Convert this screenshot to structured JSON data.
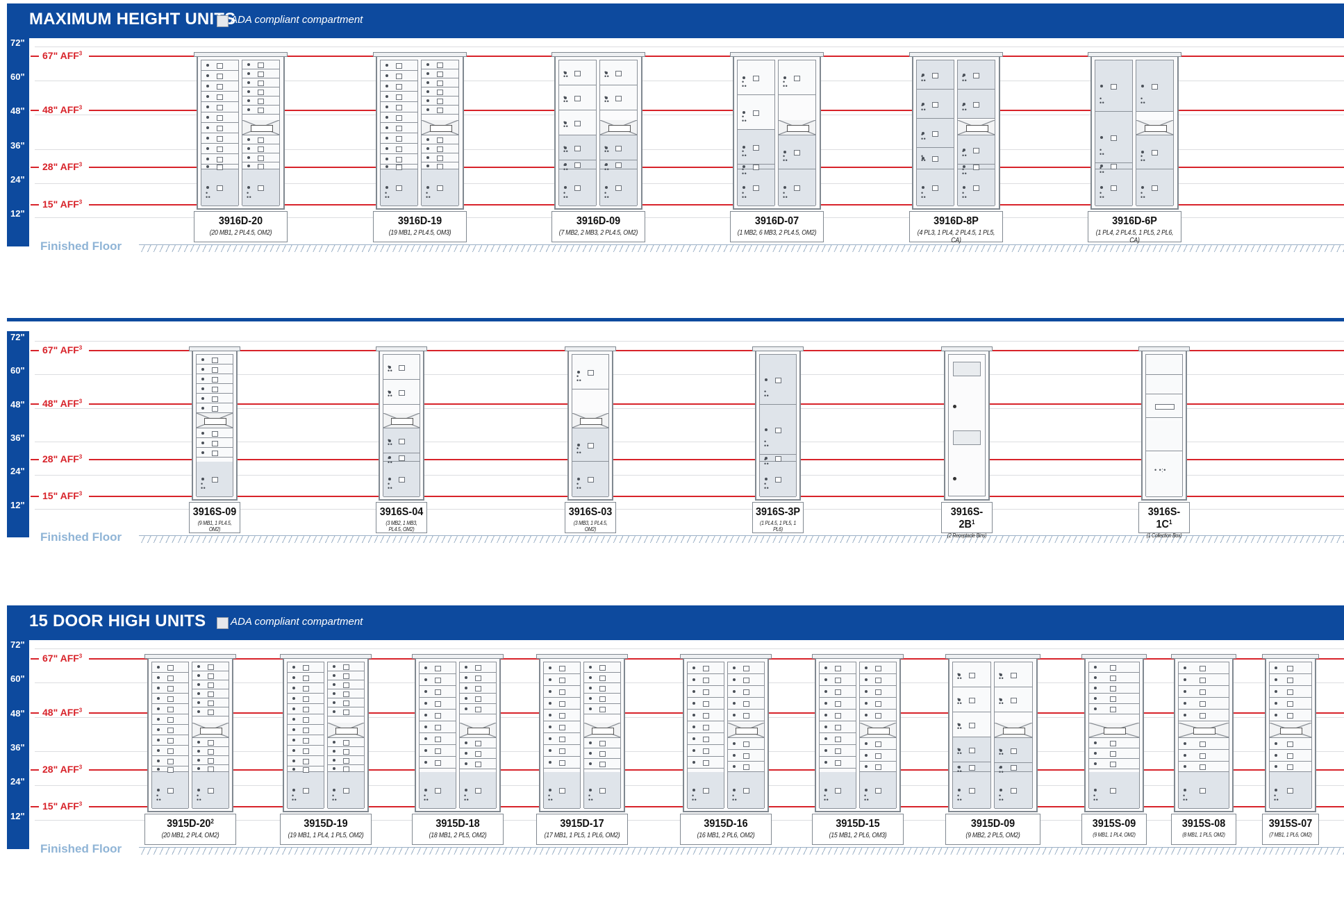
{
  "sections": [
    {
      "title": "MAXIMUM HEIGHT UNITS",
      "ada_legend": "ADA compliant compartment",
      "units": [
        {
          "name": "3916D-20",
          "sup": "",
          "desc": "(20 MB1, 2 PL4.5, OM2)",
          "cols": 2,
          "top": "mb",
          "n": 20
        },
        {
          "name": "3916D-19",
          "sup": "",
          "desc": "(19 MB1, 2 PL4.5, OM3)",
          "cols": 2,
          "top": "mb",
          "n": 19
        },
        {
          "name": "3916D-09",
          "sup": "",
          "desc": "(7 MB2, 2 MB3, 2 PL4.5, OM2)",
          "cols": 2,
          "top": "mb2",
          "n": 9
        },
        {
          "name": "3916D-07",
          "sup": "",
          "desc": "(1 MB2, 6 MB3, 2 PL4.5, OM2)",
          "cols": 2,
          "top": "mb3",
          "n": 7
        },
        {
          "name": "3916D-8P",
          "sup": "",
          "desc": "(4 PL3, 1 PL4, 2 PL4.5, 1 PL5, CA)",
          "cols": 2,
          "top": "pl",
          "n": 8
        },
        {
          "name": "3916D-6P",
          "sup": "",
          "desc": "(1 PL4, 2 PL4.5, 1 PL5, 2 PL6, CA)",
          "cols": 2,
          "top": "pl6",
          "n": 6
        }
      ]
    },
    {
      "title": "",
      "ada_legend": "",
      "units": [
        {
          "name": "3916S-09",
          "sup": "",
          "desc": "(9 MB1, 1 PL4.5, OM2)",
          "cols": 1,
          "top": "mb",
          "n": 9
        },
        {
          "name": "3916S-04",
          "sup": "",
          "desc": "(3 MB2, 1 MB3, PL4.5, OM2)",
          "cols": 1,
          "top": "mb2",
          "n": 4
        },
        {
          "name": "3916S-03",
          "sup": "",
          "desc": "(3 MB3, 1 PL4.5, OM2)",
          "cols": 1,
          "top": "mb3",
          "n": 3
        },
        {
          "name": "3916S-3P",
          "sup": "",
          "desc": "(1 PL4.5, 1 PL5, 1 PL6)",
          "cols": 1,
          "top": "pl6",
          "n": 3
        },
        {
          "name": "3916S-2B",
          "sup": "1",
          "desc": "(2 Receptacle Bins)",
          "cols": 1,
          "top": "bin",
          "n": 2
        },
        {
          "name": "3916S-1C",
          "sup": "1",
          "desc": "(1 Collection Box)",
          "cols": 1,
          "top": "cbox",
          "n": 1
        }
      ]
    },
    {
      "title": "15 DOOR HIGH UNITS",
      "ada_legend": "ADA compliant compartment",
      "units": [
        {
          "name": "3915D-20",
          "sup": "2",
          "desc": "(20 MB1, 2 PL4, OM2)",
          "cols": 2,
          "top": "mb",
          "n": 20
        },
        {
          "name": "3915D-19",
          "sup": "",
          "desc": "(19 MB1, 1 PL4, 1 PL5, OM2)",
          "cols": 2,
          "top": "mb",
          "n": 19
        },
        {
          "name": "3915D-18",
          "sup": "",
          "desc": "(18 MB1, 2 PL5, OM2)",
          "cols": 2,
          "top": "mb",
          "n": 18
        },
        {
          "name": "3915D-17",
          "sup": "",
          "desc": "(17 MB1, 1 PL5, 1 PL6, OM2)",
          "cols": 2,
          "top": "mb",
          "n": 17
        },
        {
          "name": "3915D-16",
          "sup": "",
          "desc": "(16 MB1, 2 PL6, OM2)",
          "cols": 2,
          "top": "mb",
          "n": 16
        },
        {
          "name": "3915D-15",
          "sup": "",
          "desc": "(15 MB1, 2 PL6, OM3)",
          "cols": 2,
          "top": "mb",
          "n": 15
        },
        {
          "name": "3915D-09",
          "sup": "",
          "desc": "(9 MB2, 2 PL5, OM2)",
          "cols": 2,
          "top": "mb2",
          "n": 9
        },
        {
          "name": "3915S-09",
          "sup": "",
          "desc": "(9 MB1, 1 PL4, OM2)",
          "cols": 1,
          "top": "mb",
          "n": 9
        },
        {
          "name": "3915S-08",
          "sup": "",
          "desc": "(8 MB1, 1 PL5, OM2)",
          "cols": 1,
          "top": "mb",
          "n": 8
        },
        {
          "name": "3915S-07",
          "sup": "",
          "desc": "(7 MB1, 1 PL6, OM2)",
          "cols": 1,
          "top": "mb",
          "n": 7
        }
      ]
    }
  ],
  "ruler_ticks": [
    "72\"",
    "60\"",
    "48\"",
    "36\"",
    "24\"",
    "12\""
  ],
  "aff_lines": [
    {
      "label": "67\" AFF",
      "sup": "3"
    },
    {
      "label": "48\" AFF",
      "sup": "3"
    },
    {
      "label": "28\" AFF",
      "sup": "3"
    },
    {
      "label": "15\" AFF",
      "sup": "3"
    }
  ],
  "floor_label": "Finished Floor",
  "colors": {
    "header_blue": "#0d4a9e",
    "aff_red": "#d8232a",
    "parcel_fill": "#dfe4ea",
    "floor_text": "#8fb4d6"
  }
}
